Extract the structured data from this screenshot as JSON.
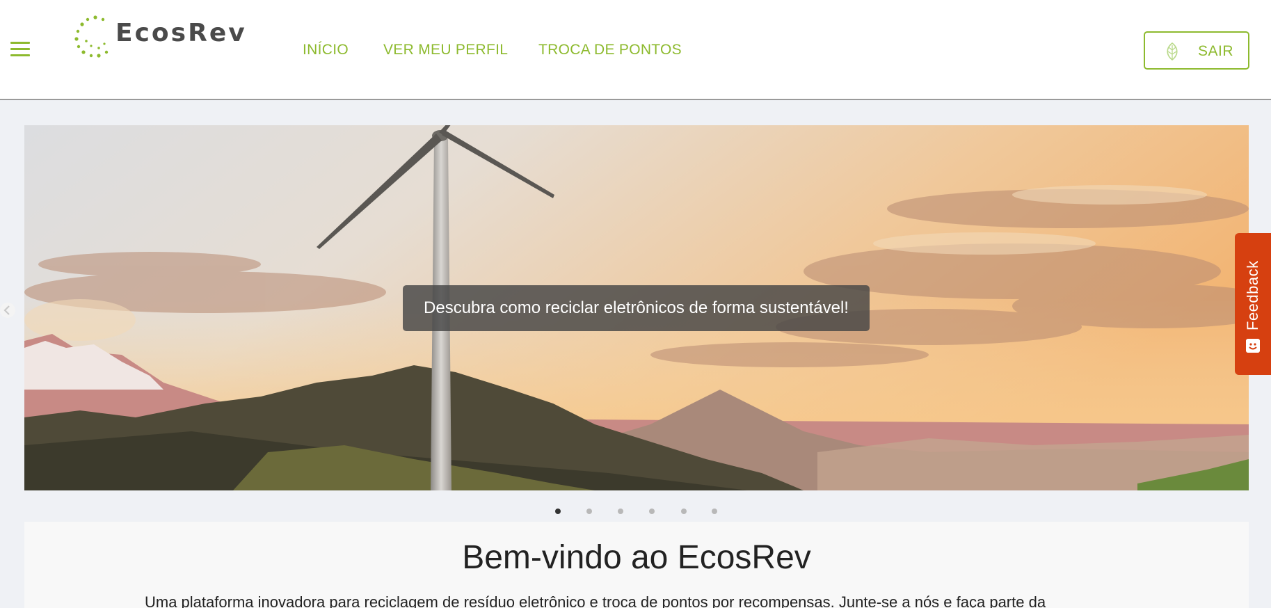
{
  "header": {
    "logo_text": "EcosRev",
    "nav": [
      {
        "label": "INÍCIO"
      },
      {
        "label": "VER MEU PERFIL"
      },
      {
        "label": "TROCA DE PONTOS"
      }
    ],
    "logout_label": "SAIR"
  },
  "carousel": {
    "caption": "Descubra como reciclar eletrônicos de forma sustentável!",
    "slide_count": 6,
    "active_slide": 1
  },
  "feedback": {
    "label": "Feedback"
  },
  "welcome": {
    "title": "Bem-vindo ao EcosRev",
    "text": "Uma plataforma inovadora para reciclagem de resíduo eletrônico e troca de pontos por recompensas. Junte-se a nós e faça parte da"
  },
  "colors": {
    "accent": "#8dba2e",
    "feedback": "#d64010",
    "page_bg": "#eff1f5"
  }
}
